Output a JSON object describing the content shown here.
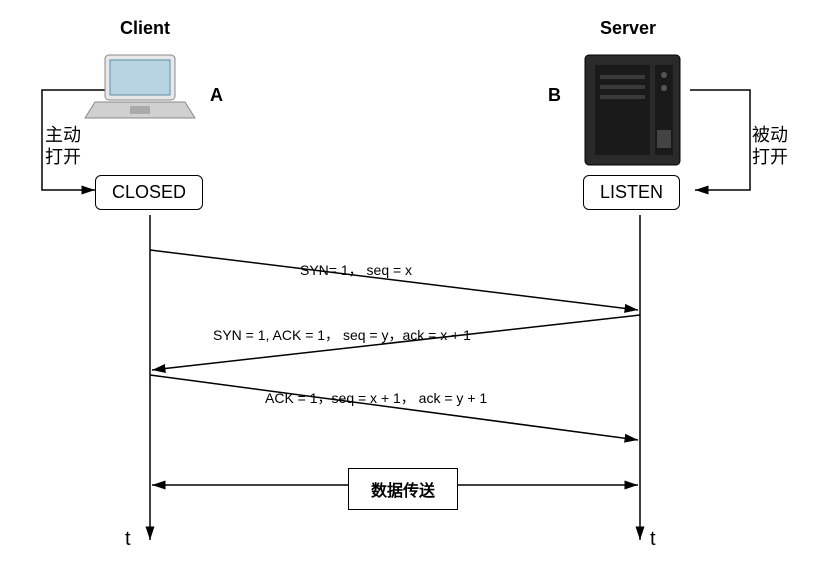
{
  "client": {
    "title": "Client",
    "letter": "A",
    "action": "主动\n打开",
    "state": "CLOSED"
  },
  "server": {
    "title": "Server",
    "letter": "B",
    "action": "被动\n打开",
    "state": "LISTEN"
  },
  "messages": {
    "m1": "SYN= 1， seq = x",
    "m2": "SYN = 1,  ACK = 1， seq = y，ack = x + 1",
    "m3": "ACK =  1，seq = x + 1， ack = y + 1"
  },
  "data_transfer": "数据传送",
  "time_label": "t",
  "chart_data": {
    "type": "sequence-diagram",
    "title": "TCP Three-Way Handshake",
    "participants": [
      {
        "id": "A",
        "name": "Client",
        "initial_state": "CLOSED",
        "open_mode": "active"
      },
      {
        "id": "B",
        "name": "Server",
        "initial_state": "LISTEN",
        "open_mode": "passive"
      }
    ],
    "messages": [
      {
        "from": "A",
        "to": "B",
        "label": "SYN=1, seq=x",
        "flags": {
          "SYN": 1
        },
        "seq": "x"
      },
      {
        "from": "B",
        "to": "A",
        "label": "SYN=1, ACK=1, seq=y, ack=x+1",
        "flags": {
          "SYN": 1,
          "ACK": 1
        },
        "seq": "y",
        "ack": "x+1"
      },
      {
        "from": "A",
        "to": "B",
        "label": "ACK=1, seq=x+1, ack=y+1",
        "flags": {
          "ACK": 1
        },
        "seq": "x+1",
        "ack": "y+1"
      }
    ],
    "post_phase": "数据传送"
  }
}
